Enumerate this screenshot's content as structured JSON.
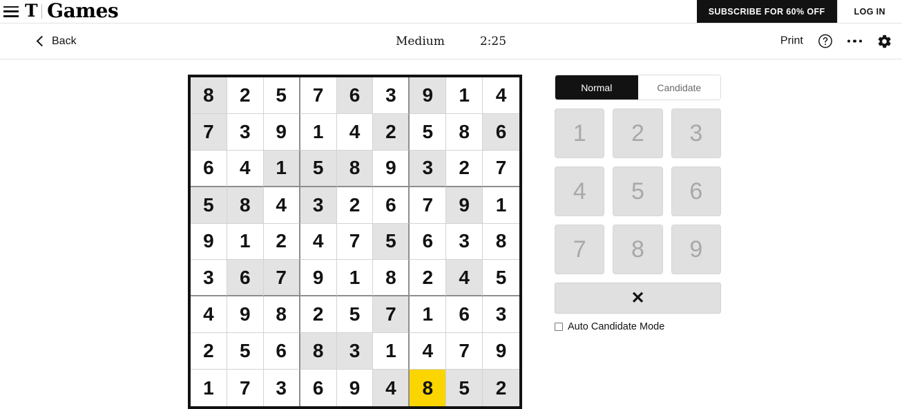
{
  "header": {
    "menu_icon": "hamburger-icon",
    "logo_t": "T",
    "logo_text": "Games",
    "subscribe_label": "SUBSCRIBE FOR 60% OFF",
    "login_label": "LOG IN"
  },
  "toolbar": {
    "back_label": "Back",
    "difficulty": "Medium",
    "timer": "2:25",
    "print_label": "Print",
    "help_icon": "question-circle-icon",
    "more_icon": "ellipsis-icon",
    "settings_icon": "gear-icon"
  },
  "board": {
    "rows": [
      [
        8,
        2,
        5,
        7,
        6,
        3,
        9,
        1,
        4
      ],
      [
        7,
        3,
        9,
        1,
        4,
        2,
        5,
        8,
        6
      ],
      [
        6,
        4,
        1,
        5,
        8,
        9,
        3,
        2,
        7
      ],
      [
        5,
        8,
        4,
        3,
        2,
        6,
        7,
        9,
        1
      ],
      [
        9,
        1,
        2,
        4,
        7,
        5,
        6,
        3,
        8
      ],
      [
        3,
        6,
        7,
        9,
        1,
        8,
        2,
        4,
        5
      ],
      [
        4,
        9,
        8,
        2,
        5,
        7,
        1,
        6,
        3
      ],
      [
        2,
        5,
        6,
        8,
        3,
        1,
        4,
        7,
        9
      ],
      [
        1,
        7,
        3,
        6,
        9,
        4,
        8,
        5,
        2
      ]
    ],
    "highlighted_cells": [
      [
        1,
        1
      ],
      [
        1,
        5
      ],
      [
        1,
        7
      ],
      [
        2,
        1
      ],
      [
        2,
        6
      ],
      [
        2,
        9
      ],
      [
        3,
        3
      ],
      [
        3,
        4
      ],
      [
        3,
        5
      ],
      [
        3,
        7
      ],
      [
        4,
        1
      ],
      [
        4,
        2
      ],
      [
        4,
        4
      ],
      [
        4,
        8
      ],
      [
        5,
        6
      ],
      [
        6,
        2
      ],
      [
        6,
        3
      ],
      [
        6,
        8
      ],
      [
        7,
        6
      ],
      [
        8,
        4
      ],
      [
        8,
        5
      ],
      [
        9,
        6
      ],
      [
        9,
        8
      ],
      [
        9,
        9
      ]
    ],
    "selected_cell": [
      9,
      7
    ],
    "selected_color": "#fad500",
    "peer_color": "#e3e3e3"
  },
  "controls": {
    "mode_normal": "Normal",
    "mode_candidate": "Candidate",
    "active_mode": "Normal",
    "numbers": [
      "1",
      "2",
      "3",
      "4",
      "5",
      "6",
      "7",
      "8",
      "9"
    ],
    "erase_icon": "✕",
    "auto_candidate_label": "Auto Candidate Mode",
    "auto_candidate_checked": false
  }
}
